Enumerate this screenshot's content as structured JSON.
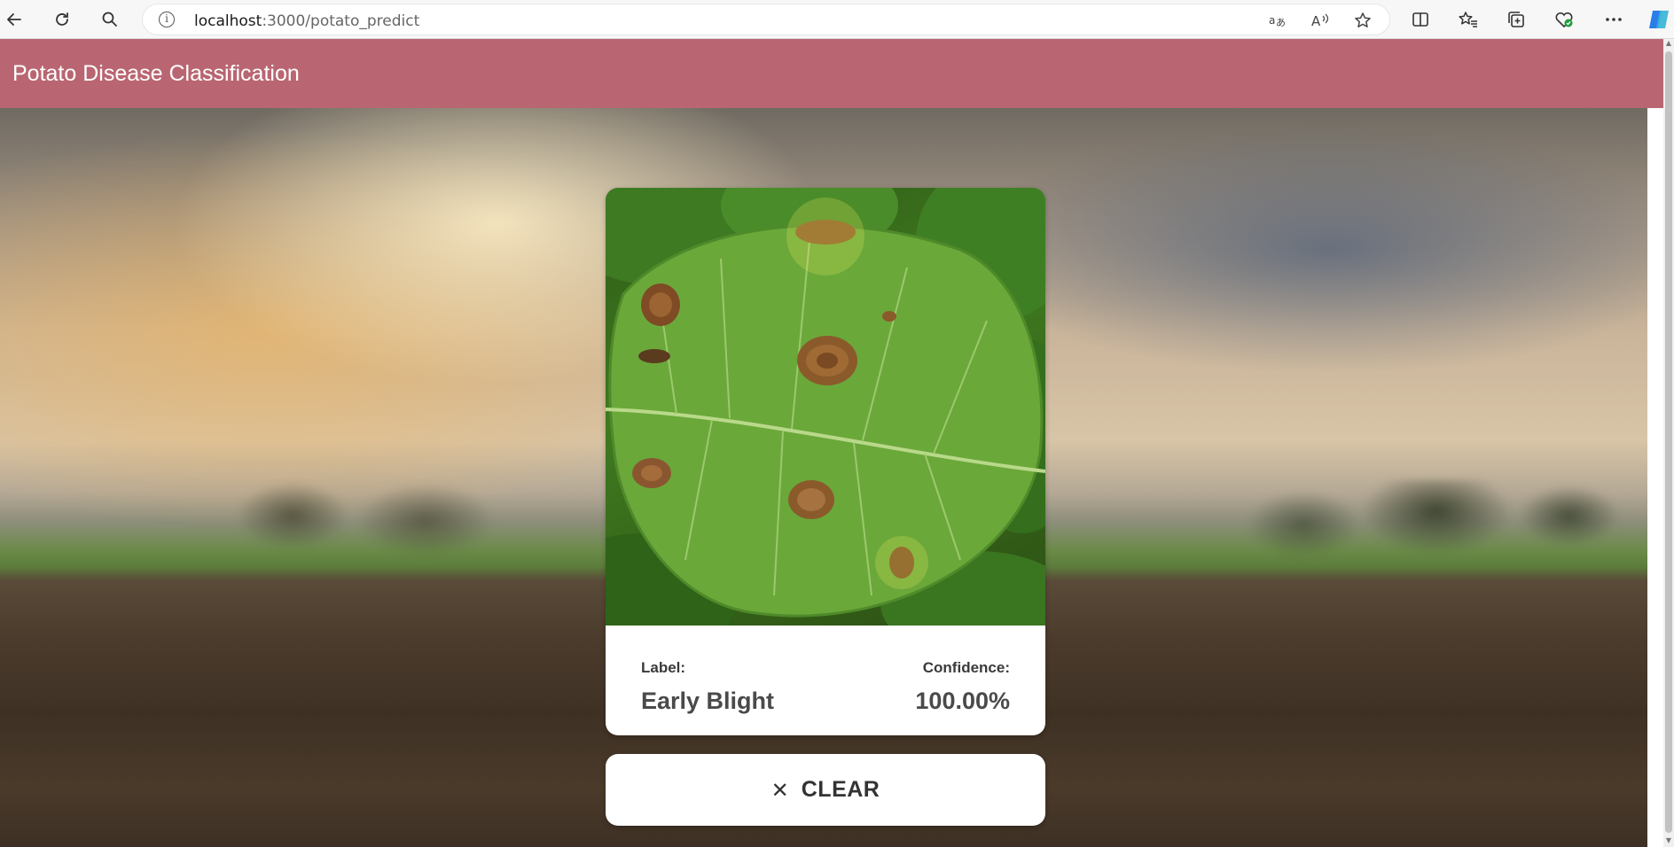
{
  "browser": {
    "url_host": "localhost",
    "url_path": ":3000/potato_predict",
    "icons": {
      "back": "back-arrow-icon",
      "refresh": "refresh-icon",
      "search": "search-icon",
      "info": "site-info-icon",
      "translate": "translate-icon",
      "read_aloud": "read-aloud-icon",
      "favorite": "star-icon",
      "split": "split-screen-icon",
      "favorites_list": "favorites-icon",
      "collections": "collections-icon",
      "health": "browser-essentials-icon",
      "more": "more-icon",
      "copilot": "copilot-icon"
    }
  },
  "app": {
    "title": "Potato Disease Classification",
    "header_color": "#b96672"
  },
  "result": {
    "label_heading": "Label:",
    "label_value": "Early Blight",
    "confidence_heading": "Confidence:",
    "confidence_value": "100.00%"
  },
  "actions": {
    "clear_label": "CLEAR",
    "clear_icon": "close-icon"
  },
  "image": {
    "subject": "potato-leaf-photo"
  }
}
